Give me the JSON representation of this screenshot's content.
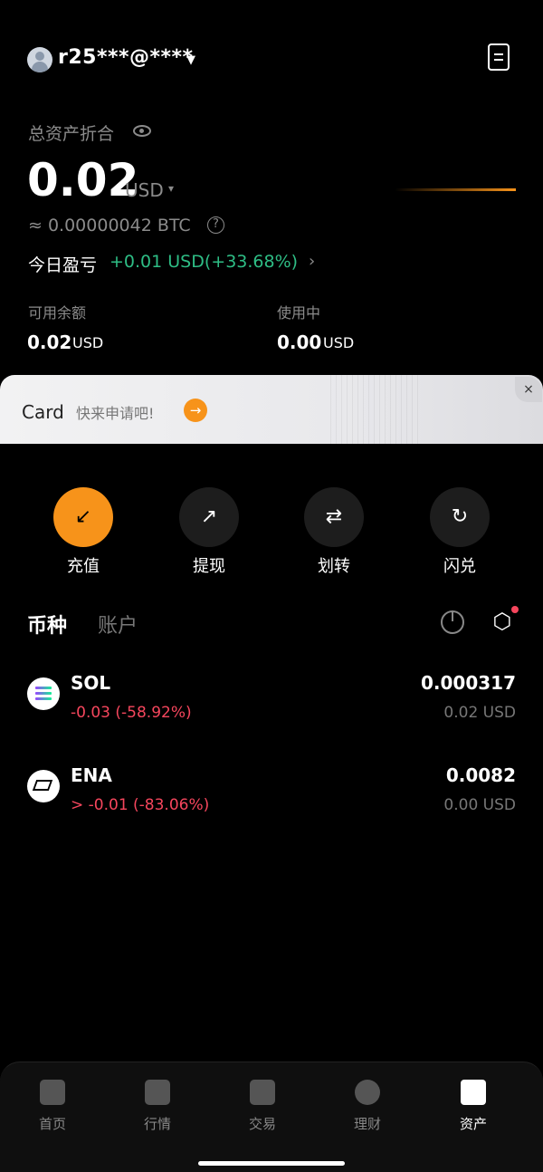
{
  "header": {
    "account": "r25***@****",
    "caret": "▼"
  },
  "summary": {
    "total_label": "总资产折合",
    "total_value": "0.02",
    "total_unit": "USD",
    "unit_caret": "▾",
    "btc_value": "≈ 0.00000042 BTC",
    "help": "?",
    "pnl_label": "今日盈亏",
    "pnl_value": "+0.01 USD(+33.68%)",
    "pnl_arrow": "›",
    "available_label": "可用余额",
    "available_value": "0.02",
    "available_unit": "USD",
    "in_use_label": "使用中",
    "in_use_value": "0.00",
    "in_use_unit": "USD"
  },
  "banner": {
    "title": "Card",
    "subtitle": "快来申请吧!",
    "go": "→",
    "close": "×"
  },
  "actions": [
    {
      "label": "充值",
      "glyph": "↙"
    },
    {
      "label": "提现",
      "glyph": "↗"
    },
    {
      "label": "划转",
      "glyph": "⇄"
    },
    {
      "label": "闪兑",
      "glyph": "↻"
    }
  ],
  "tabs": {
    "active": "币种",
    "other": "账户"
  },
  "coins": [
    {
      "symbol": "SOL",
      "change": "-0.03 (-58.92%)",
      "amount": "0.000317",
      "usd": "0.02 USD"
    },
    {
      "symbol": "ENA",
      "change": "> -0.01 (-83.06%)",
      "amount": "0.0082",
      "usd": "0.00 USD"
    }
  ],
  "gear_glyph": "⬡",
  "nav": [
    {
      "label": "首页"
    },
    {
      "label": "行情"
    },
    {
      "label": "交易"
    },
    {
      "label": "理财"
    },
    {
      "label": "资产"
    }
  ],
  "colors": {
    "accent": "#f7931a",
    "positive": "#2ebd85",
    "negative": "#f6465d"
  }
}
